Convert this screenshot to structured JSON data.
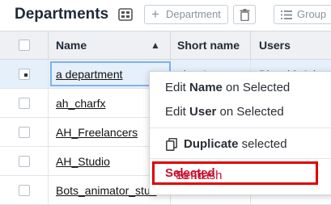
{
  "header": {
    "title": "Departments",
    "buttons": {
      "add_department": "Department",
      "group": "Group"
    }
  },
  "table": {
    "columns": [
      "Name",
      "Short name",
      "Users"
    ],
    "rows": [
      {
        "name": "a department",
        "short": "dep 1",
        "users": "Blanchi, Ad"
      },
      {
        "name": "ah_charfx",
        "short": "",
        "users": ""
      },
      {
        "name": "AH_Freelancers",
        "short": "",
        "users": ""
      },
      {
        "name": "AH_Studio",
        "short": "",
        "users": ""
      },
      {
        "name": "Bots_animator_stud",
        "short": "",
        "users": ""
      }
    ]
  },
  "context_menu": {
    "edit_name": {
      "pre": "Edit ",
      "bold": "Name",
      "post": " on Selected"
    },
    "edit_user": {
      "pre": "Edit ",
      "bold": "User",
      "post": " on Selected"
    },
    "duplicate": {
      "bold": "Duplicate",
      "post": " selected"
    },
    "send_trash": {
      "pre": "Send ",
      "bold": "Selected",
      "post": " To Trash"
    }
  }
}
